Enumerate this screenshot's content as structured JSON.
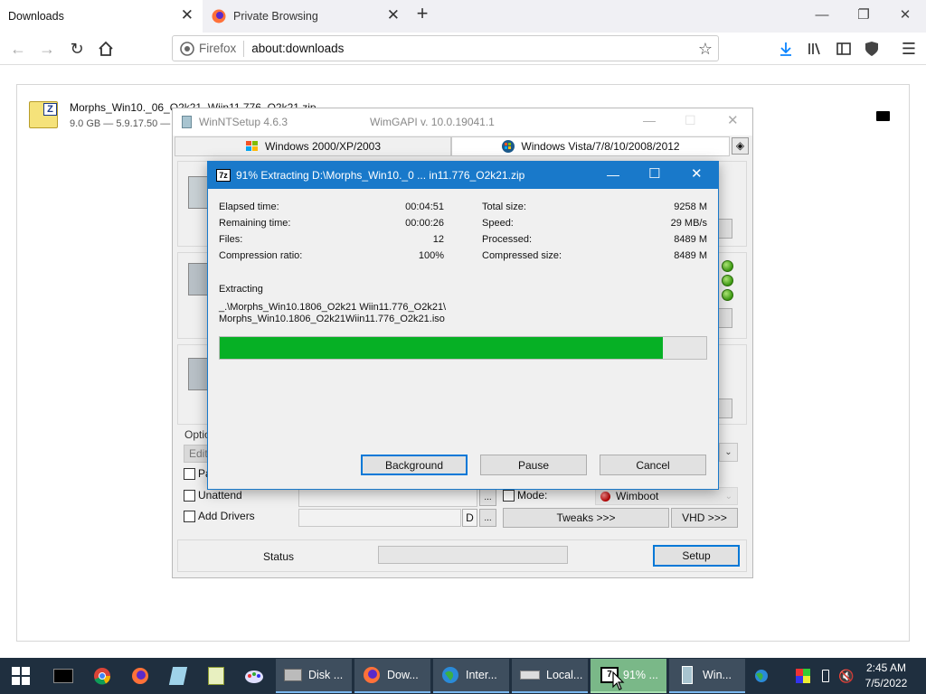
{
  "browser": {
    "tabs": [
      {
        "label": "Downloads"
      },
      {
        "label": "Private Browsing"
      }
    ],
    "identity_label": "Firefox",
    "url": "about:downloads"
  },
  "download": {
    "filename": "Morphs_Win10._06_O2k21_Wiin11.776_O2k21.zip",
    "details": "9.0 GB — 5.9.17.50 — 2"
  },
  "winntsetup": {
    "title": "WinNTSetup 4.6.3",
    "wimgapi": "WimGAPI v. 10.0.19041.1",
    "tabs": [
      "Windows 2000/XP/2003",
      "Windows Vista/7/8/10/2008/2012"
    ],
    "options_label": "Optio",
    "edit_label": "Edit",
    "pa_label": "Pa",
    "unattend_label": "Unattend",
    "add_drivers_label": "Add Drivers",
    "d_label": "D",
    "dots_label": "...",
    "mode_label": "Mode:",
    "mode_value": "Wimboot",
    "tweaks_label": "Tweaks >>>",
    "vhd_label": "VHD >>>",
    "status_label": "Status",
    "setup_label": "Setup"
  },
  "extract": {
    "title": "91% Extracting D:\\Morphs_Win10._0 ... in11.776_O2k21.zip",
    "progress_percent": 91,
    "left_stats": [
      {
        "label": "Elapsed time:",
        "value": "00:04:51"
      },
      {
        "label": "Remaining time:",
        "value": "00:00:26"
      },
      {
        "label": "Files:",
        "value": "12"
      },
      {
        "label": "Compression ratio:",
        "value": "100%"
      }
    ],
    "right_stats": [
      {
        "label": "Total size:",
        "value": "9258 M"
      },
      {
        "label": "Speed:",
        "value": "29 MB/s"
      },
      {
        "label": "Processed:",
        "value": "8489 M"
      },
      {
        "label": "Compressed size:",
        "value": "8489 M"
      }
    ],
    "extracting_label": "Extracting",
    "path_line1": "_.\\Morphs_Win10.1806_O2k21 Wiin11.776_O2k21\\",
    "path_line2": "Morphs_Win10.1806_O2k21Wiin11.776_O2k21.iso",
    "buttons": {
      "background": "Background",
      "pause": "Pause",
      "cancel": "Cancel"
    }
  },
  "taskbar": {
    "groups": [
      {
        "label": "Disk ..."
      },
      {
        "label": "Dow..."
      },
      {
        "label": "Inter..."
      },
      {
        "label": "Local..."
      },
      {
        "label": "91% ..."
      },
      {
        "label": "Win..."
      }
    ],
    "time": "2:45 AM",
    "date": "7/5/2022"
  },
  "colors": {
    "accent": "#1979ca",
    "progress": "#06b025",
    "taskbar": "#1f2f3f"
  }
}
